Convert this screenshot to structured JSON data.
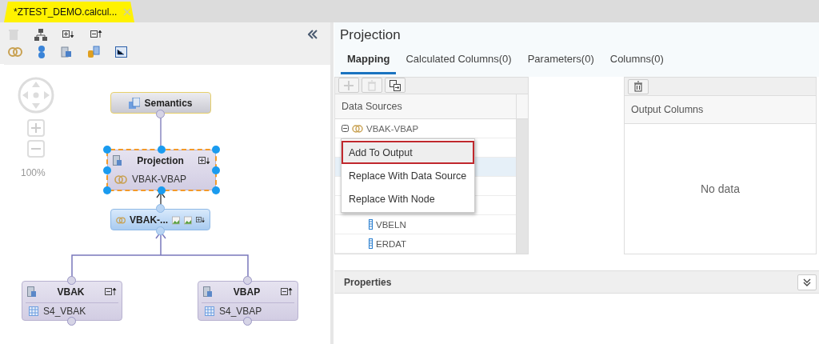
{
  "editor_tab": {
    "title": "*ZTEST_DEMO.calcul..."
  },
  "canvas": {
    "zoom": "100%"
  },
  "nodes": [
    {
      "kind": "semantics",
      "title": "Semantics",
      "selected": false
    },
    {
      "kind": "projection",
      "title": "Projection",
      "source": "VBAK-VBAP",
      "selected": true
    },
    {
      "kind": "join",
      "title": "VBAK-...",
      "selected": false
    },
    {
      "kind": "table",
      "title": "VBAK",
      "source": "S4_VBAK",
      "selected": false
    },
    {
      "kind": "table",
      "title": "VBAP",
      "source": "S4_VBAP",
      "selected": false
    }
  ],
  "panel": {
    "title": "Projection"
  },
  "tabs": [
    {
      "label": "Mapping",
      "selected": true
    },
    {
      "label": "Calculated Columns(0)",
      "selected": false
    },
    {
      "label": "Parameters(0)",
      "selected": false
    },
    {
      "label": "Columns(0)",
      "selected": false
    }
  ],
  "data_sources": {
    "header": "Data Sources",
    "root": {
      "label": "VBAK-VBAP",
      "expanded": true,
      "children": [
        {
          "label": "VBELN"
        },
        {
          "label": "ERDAT"
        }
      ]
    }
  },
  "context_menu": [
    {
      "label": "Add To Output",
      "selected": true
    },
    {
      "label": "Replace With Data Source",
      "selected": false
    },
    {
      "label": "Replace With Node",
      "selected": false
    }
  ],
  "output_columns": {
    "header": "Output Columns",
    "empty_text": "No data"
  },
  "properties": {
    "title": "Properties"
  }
}
